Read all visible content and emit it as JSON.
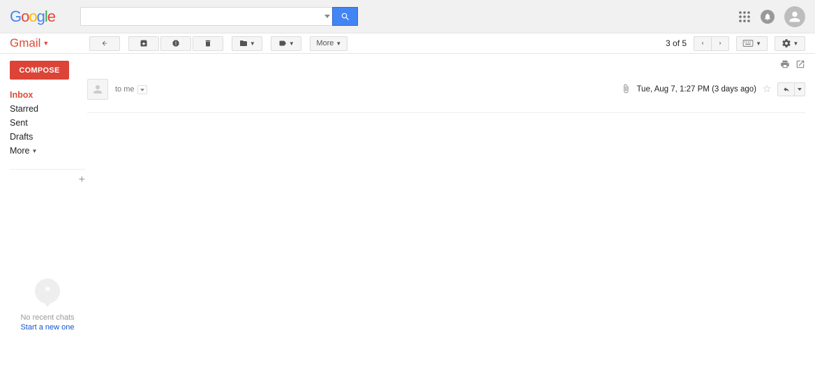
{
  "logo": {
    "letters": [
      "G",
      "o",
      "o",
      "g",
      "l",
      "e"
    ]
  },
  "search": {
    "value": ""
  },
  "appLabel": "Gmail",
  "toolbar": {
    "moreLabel": "More",
    "countText": "3 of 5"
  },
  "compose": "COMPOSE",
  "nav": {
    "inbox": "Inbox",
    "starred": "Starred",
    "sent": "Sent",
    "drafts": "Drafts",
    "more": "More"
  },
  "chat": {
    "noRecent": "No recent chats",
    "startNew": "Start a new one"
  },
  "message": {
    "to": "to me",
    "date": "Tue, Aug 7, 1:27 PM (3 days ago)"
  }
}
